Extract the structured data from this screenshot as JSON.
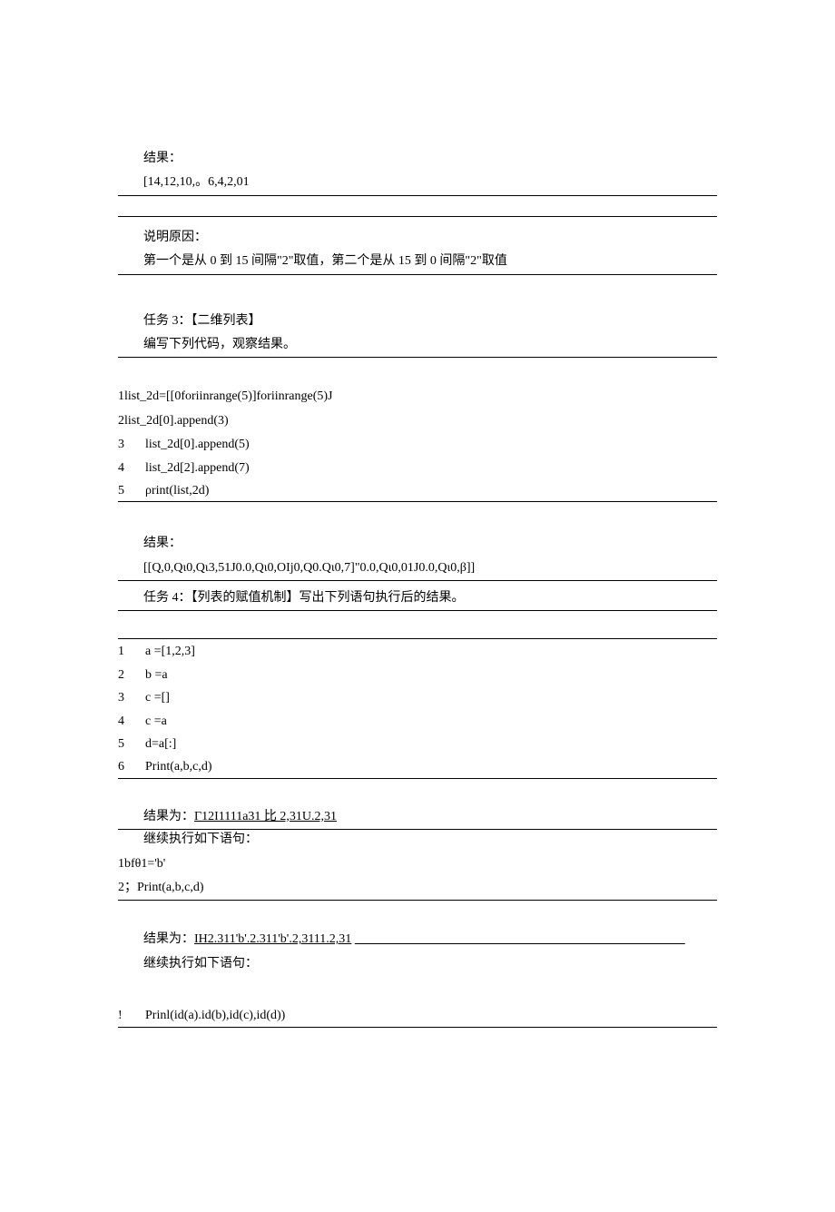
{
  "result1_label": "结果：",
  "result1_value": " [14,12,10,。6,4,2,01",
  "explain_label": "说明原因：",
  "explain_value": " 第一个是从 0 到 15 间隔\"2\"取值，第二个是从 15 到 0 间隔\"2\"取值",
  "task3_title": "任务 3：【二维列表】",
  "task3_instr": "编写下列代码，观察结果。",
  "code1": {
    "l1": "1list_2d=[[0foriinrange(5)]foriinrange(5)J",
    "l2": "2list_2d[0].append(3)",
    "l3n": "3",
    "l3t": "list_2d[0].append(5)",
    "l4n": "4",
    "l4t": "list_2d[2].append(7)",
    "l5n": "5",
    "l5t": "ρrint(list,2d)"
  },
  "result2_label": "结果：",
  "result2_value": " [[Q,0,Qι0,Qι3,51J0.0,Qι0,OIj0,Q0.Qι0,7]\"0.0,Qι0,01J0.0,Qι0,β]]",
  "task4_title": "任务 4：【列表的赋值机制】写出下列语句执行后的结果。",
  "code2": {
    "l1n": "1",
    "l1t": "a   =[1,2,3]",
    "l2n": "2",
    "l2t": "b   =a",
    "l3n": "3",
    "l3t": "c   =[]",
    "l4n": "4",
    "l4t": "c   =a",
    "l5n": "5",
    "l5t": "d=a[:]",
    "l6n": "6",
    "l6t": "Print(a,b,c,d)"
  },
  "result3_prefix": "结果为：",
  "result3_value": "Γ12I1111a31 比 2,31U.2,31",
  "cont1": "继续执行如下语句：",
  "code3": {
    "l1": "1bfθ1='b'",
    "l2": "2；Print(a,b,c,d)"
  },
  "result4_prefix": "结果为：",
  "result4_value": "IH2.311'b'.2.311'b'.2,3111.2,31",
  "cont2": "继续执行如下语句：",
  "code4": {
    "l1n": "!",
    "l1t": "Prinl(id(a).id(b),id(c),id(d))"
  }
}
